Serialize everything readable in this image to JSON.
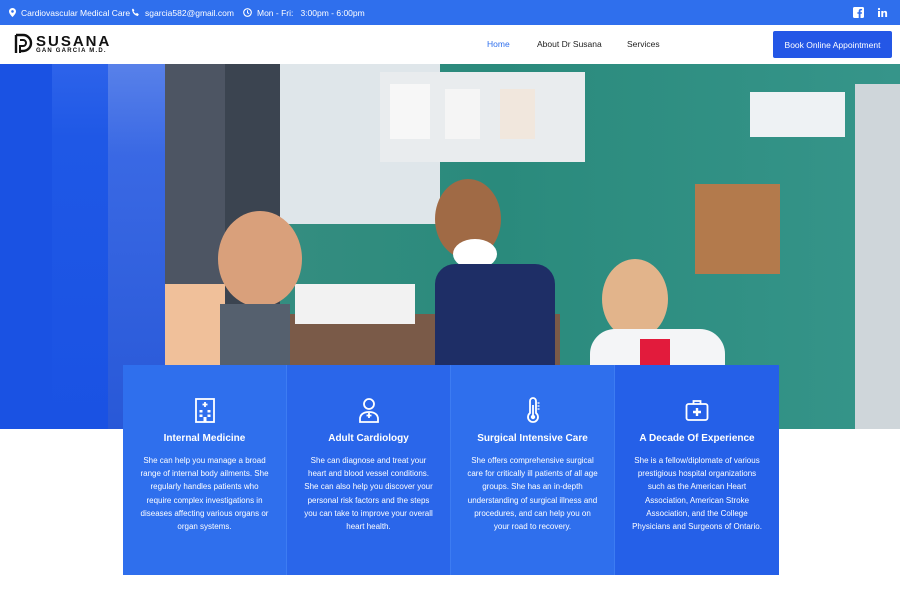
{
  "topbar": {
    "specialty": "Cardiovascular Medical Care",
    "email": "sgarcia582@gmail.com",
    "hours": "Mon - Fri:   3:00pm - 6:00pm",
    "bg_color": "#2f6fed"
  },
  "header": {
    "logo_name": "SUSANA",
    "logo_sub": "GAN GARCIA M.D.",
    "nav": [
      {
        "label": "Home"
      },
      {
        "label": "About Dr Susana"
      },
      {
        "label": "Services"
      }
    ],
    "cta_label": "Book Online Appointment"
  },
  "cards": [
    {
      "icon": "hospital-icon",
      "title": "Internal Medicine",
      "text": "She can help you manage a broad range of internal body ailments. She regularly handles patients who require complex investigations in diseases affecting various organs or organ systems."
    },
    {
      "icon": "doctor-icon",
      "title": "Adult Cardiology",
      "text": "She can diagnose and treat your heart and blood vessel conditions. She can also help you discover your personal risk factors and the steps you can take to improve your overall heart health."
    },
    {
      "icon": "thermometer-icon",
      "title": "Surgical Intensive Care",
      "text": "She offers comprehensive surgical care for critically ill patients of all age groups. She has an in-depth understanding of surgical illness and procedures, and can help you on your road to recovery."
    },
    {
      "icon": "first-aid-kit-icon",
      "title": "A Decade Of Experience",
      "text": "She is a fellow/diplomate of various prestigious hospital organizations such as the American Heart Association, American Stroke Association, and the College Physicians and Surgeons of Ontario."
    }
  ],
  "colors": {
    "accent": "#2f6fed",
    "hero_blue": "#1a52e3"
  }
}
